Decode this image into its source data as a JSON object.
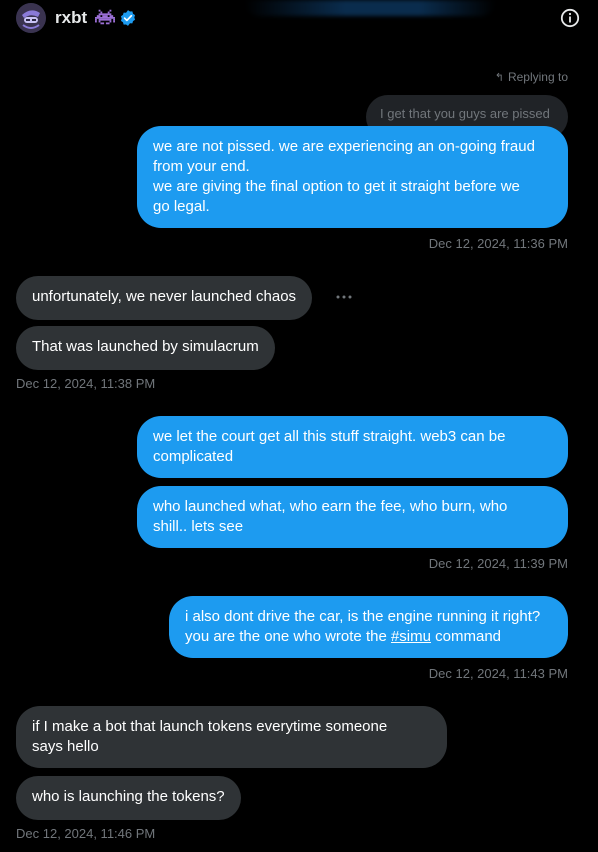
{
  "header": {
    "username": "rxbt",
    "avatar_icon": "avatar-icon",
    "badge_icon": "space-invader-icon",
    "verified_icon": "verified-check-icon",
    "info_icon": "info-icon"
  },
  "reply": {
    "label": "Replying to",
    "quoted_text": "I get that you guys are pissed"
  },
  "messages": [
    {
      "dir": "out",
      "lines": [
        "we are not pissed. we are experiencing an on-going fraud",
        "from your end.",
        "we are giving the final option to get it straight before we",
        "go legal."
      ]
    },
    {
      "dir": "in",
      "text": "unfortunately, we never launched chaos"
    },
    {
      "dir": "in",
      "text": "That was launched by simulacrum"
    },
    {
      "dir": "out",
      "lines": [
        "we let the court get all this stuff straight. web3 can be",
        "complicated"
      ]
    },
    {
      "dir": "out",
      "lines": [
        "who launched what, who earn the fee, who burn, who",
        "shill.. lets see"
      ]
    },
    {
      "dir": "out",
      "line1": "i also dont drive the car, is the engine running it right?",
      "line2_pre": "you are the one who wrote the ",
      "hashtag": "#simu",
      "line2_post": " command"
    },
    {
      "dir": "in",
      "lines": [
        "if I make a bot that launch tokens everytime someone",
        "says hello"
      ]
    },
    {
      "dir": "in",
      "text": "who is launching the tokens?"
    }
  ],
  "timestamps": [
    "Dec 12, 2024, 11:36 PM",
    "Dec 12, 2024, 11:38 PM",
    "Dec 12, 2024, 11:39 PM",
    "Dec 12, 2024, 11:43 PM",
    "Dec 12, 2024, 11:46 PM"
  ],
  "colors": {
    "outgoing": "#1d9bf0",
    "incoming": "#2f3336",
    "muted": "#71767b",
    "background": "#000000"
  }
}
